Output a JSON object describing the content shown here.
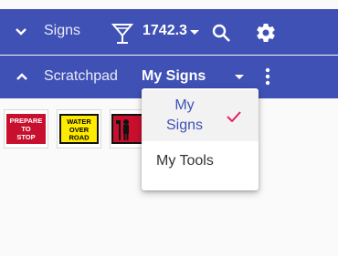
{
  "toolbar": {
    "title": "Signs",
    "count": "1742.3"
  },
  "scratchpad": {
    "label": "Scratchpad",
    "selected": "My Signs"
  },
  "signs": [
    {
      "text": "PREPARE TO STOP",
      "icon": "prepare-to-stop-sign"
    },
    {
      "text": "WATER OVER ROAD",
      "icon": "water-over-road-sign"
    },
    {
      "text": "",
      "icon": "flagger-sign"
    }
  ],
  "menu": {
    "items": [
      {
        "label": "My Signs",
        "selected": true
      },
      {
        "label": "My Tools",
        "selected": false
      }
    ]
  },
  "colors": {
    "primary": "#3f51b5",
    "check": "#e91e63"
  }
}
